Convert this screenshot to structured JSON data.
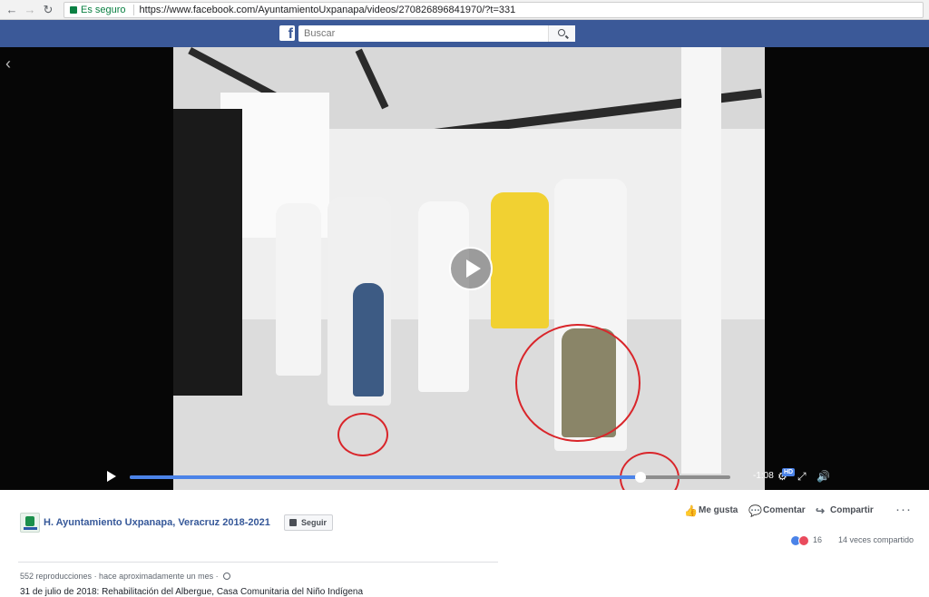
{
  "browser": {
    "secure_label": "Es seguro",
    "url": "https://www.facebook.com/AyuntamientoUxpanapa/videos/270826896841970/?t=331"
  },
  "header": {
    "logo": "f",
    "search_placeholder": "Buscar"
  },
  "video": {
    "progress": 0.85,
    "time_remaining": "-1:08",
    "hd_label": "HD",
    "icons": [
      "play-icon",
      "settings-icon",
      "fullscreen-icon",
      "volume-icon"
    ]
  },
  "post": {
    "page_name": "H. Ayuntamiento Uxpanapa, Veracruz 2018-2021",
    "follow_label": "Seguir",
    "actions": {
      "like": "Me gusta",
      "comment": "Comentar",
      "share": "Compartir"
    },
    "reaction_count": "16",
    "shares": "14 veces compartido",
    "views": "552 reproducciones",
    "posted": " · hace aproximadamente un mes · ",
    "description": "31 de julio de 2018: Rehabilitación del Albergue, Casa Comunitaria del Niño Indígena"
  },
  "colors": {
    "facebook_blue": "#3b5998",
    "progress_blue": "#4b83e8",
    "annotation_red": "#d9252a"
  }
}
